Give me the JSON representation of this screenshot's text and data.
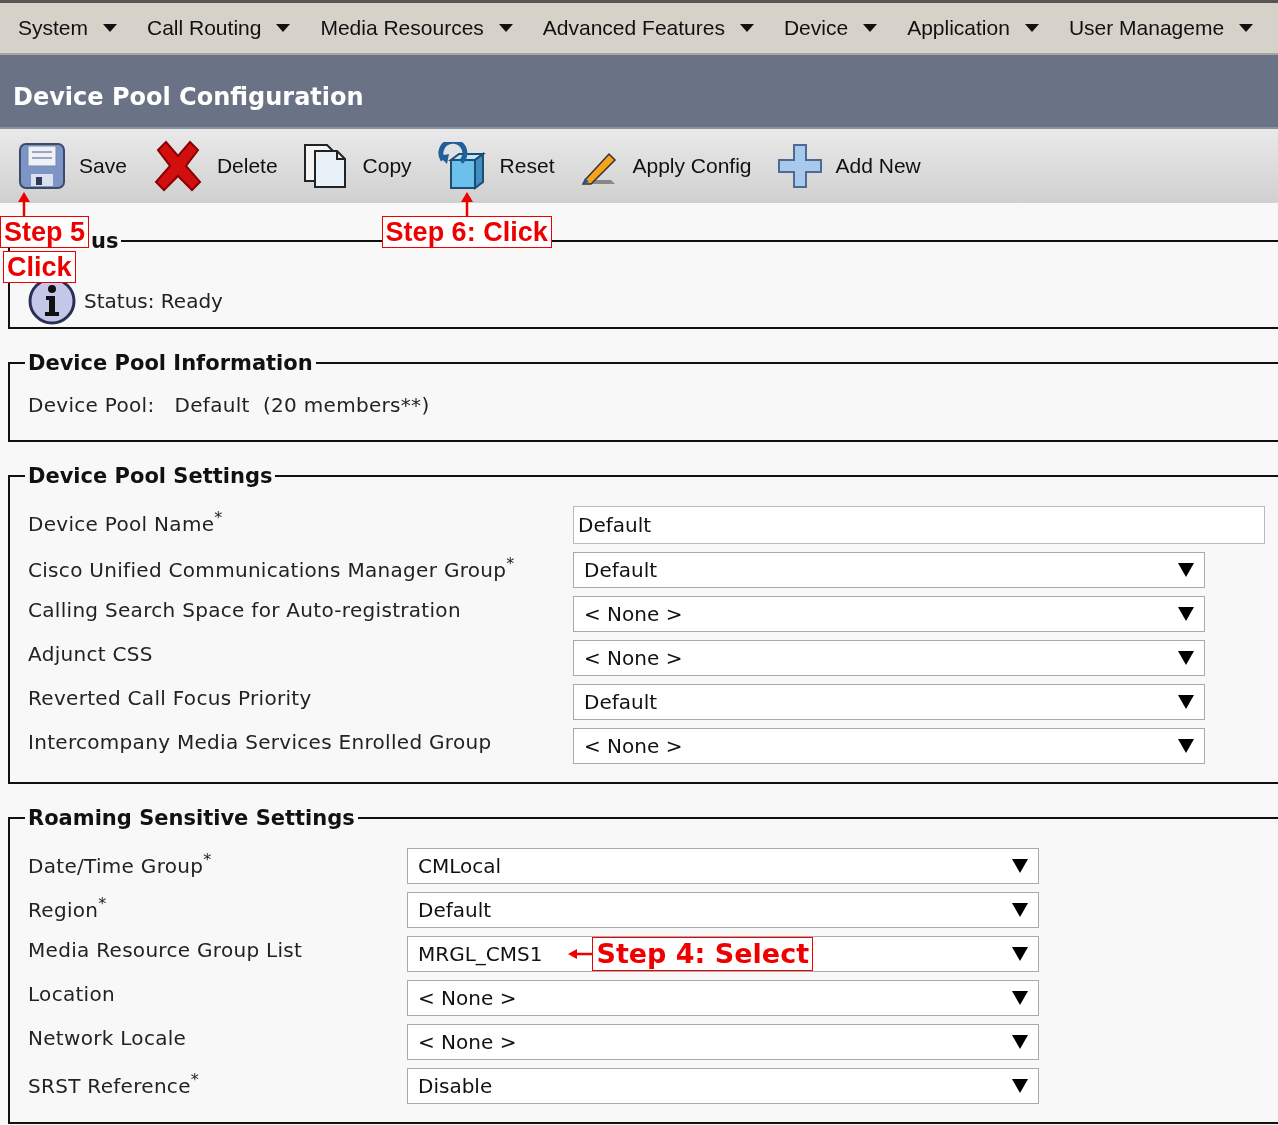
{
  "menu": [
    {
      "label": "System"
    },
    {
      "label": "Call Routing"
    },
    {
      "label": "Media Resources"
    },
    {
      "label": "Advanced Features"
    },
    {
      "label": "Device"
    },
    {
      "label": "Application"
    },
    {
      "label": "User Manageme"
    }
  ],
  "title": "Device Pool Configuration",
  "toolbar": [
    {
      "kind": "save",
      "label": "Save",
      "callout": [
        "Step 5",
        "Click"
      ]
    },
    {
      "kind": "delete",
      "label": "Delete"
    },
    {
      "kind": "copy",
      "label": "Copy"
    },
    {
      "kind": "reset",
      "label": "Reset",
      "callout": [
        "Step 6: Click"
      ]
    },
    {
      "kind": "apply",
      "label": "Apply Config"
    },
    {
      "kind": "add",
      "label": "Add New"
    }
  ],
  "status": {
    "legend": "us",
    "text": "Status: Ready"
  },
  "info": {
    "legend": "Device Pool Information",
    "label": "Device Pool:",
    "value": "Default  (20 members**)"
  },
  "sections": [
    {
      "legend": "Device Pool Settings",
      "fields": [
        {
          "label": "Device Pool Name$^{*}$",
          "kind": "text",
          "value": "Default"
        },
        {
          "label": "Cisco Unified Communications Manager Group$^{*}$",
          "kind": "select",
          "value": "Default"
        },
        {
          "label": "Calling Search Space for Auto-registration",
          "kind": "select",
          "value": "< None >"
        },
        {
          "label": "Adjunct CSS",
          "kind": "select",
          "value": "< None >"
        },
        {
          "label": "Reverted Call Focus Priority",
          "kind": "select",
          "value": "Default"
        },
        {
          "label": "Intercompany Media Services Enrolled Group",
          "kind": "select",
          "value": "< None >"
        }
      ]
    },
    {
      "legend": "Roaming Sensitive Settings",
      "fields": [
        {
          "label": "Date/Time Group$^{*}$",
          "kind": "select",
          "value": "CMLocal"
        },
        {
          "label": "Region$^{*}$",
          "kind": "select",
          "value": "Default"
        },
        {
          "label": "Media Resource Group List",
          "kind": "select",
          "value": "MRGL_CMS1",
          "callout": "Step 4: Select"
        },
        {
          "label": "Location",
          "kind": "select",
          "value": "< None >"
        },
        {
          "label": "Network Locale",
          "kind": "select",
          "value": "< None >"
        },
        {
          "label": "SRST Reference$^{*}$",
          "kind": "select",
          "value": "Disable"
        }
      ]
    }
  ]
}
